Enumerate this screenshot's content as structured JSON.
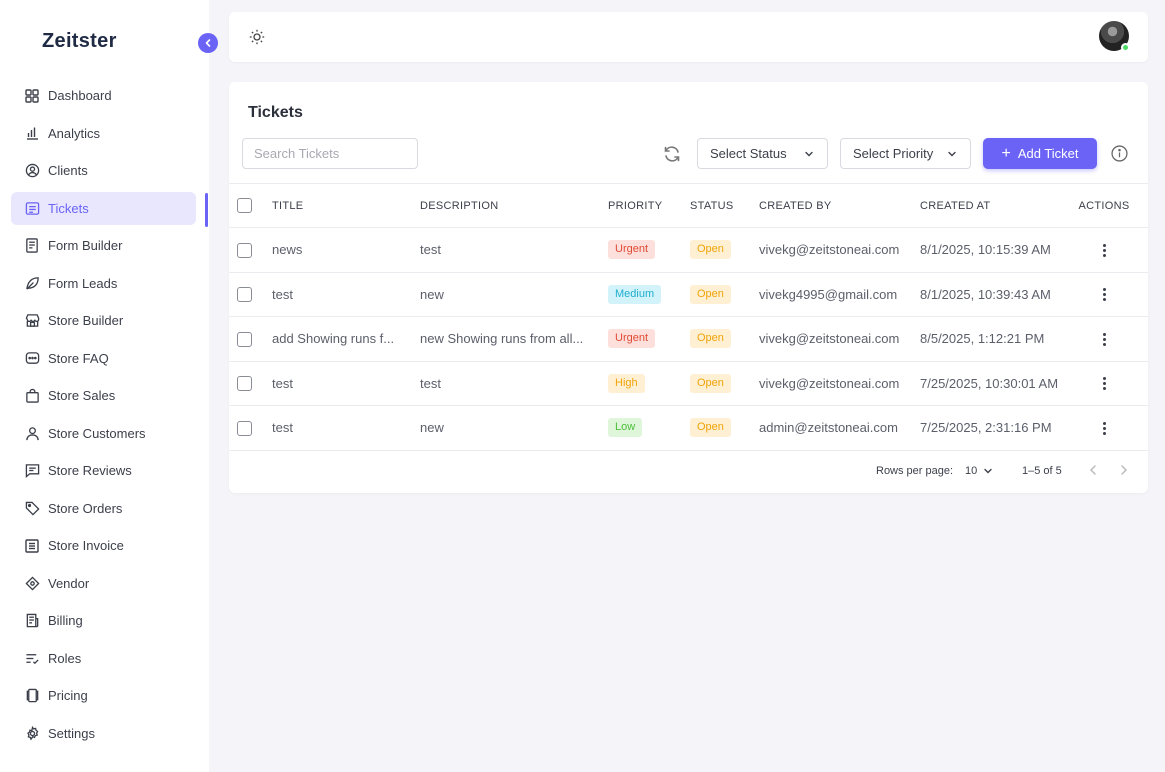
{
  "app": {
    "logo_text": "Zeitster"
  },
  "sidebar": {
    "items": [
      {
        "label": "Dashboard",
        "icon": "grid-icon"
      },
      {
        "label": "Analytics",
        "icon": "bar-chart-icon"
      },
      {
        "label": "Clients",
        "icon": "user-circle-icon"
      },
      {
        "label": "Tickets",
        "icon": "ticket-list-icon",
        "active": true
      },
      {
        "label": "Form Builder",
        "icon": "form-icon"
      },
      {
        "label": "Form Leads",
        "icon": "leaf-icon"
      },
      {
        "label": "Store Builder",
        "icon": "store-icon"
      },
      {
        "label": "Store FAQ",
        "icon": "chat-dots-icon"
      },
      {
        "label": "Store Sales",
        "icon": "shopping-bag-icon"
      },
      {
        "label": "Store Customers",
        "icon": "person-icon"
      },
      {
        "label": "Store Reviews",
        "icon": "message-icon"
      },
      {
        "label": "Store Orders",
        "icon": "tag-icon"
      },
      {
        "label": "Store Invoice",
        "icon": "invoice-icon"
      },
      {
        "label": "Vendor",
        "icon": "vendor-icon"
      },
      {
        "label": "Billing",
        "icon": "receipt-icon"
      },
      {
        "label": "Roles",
        "icon": "roles-list-icon"
      },
      {
        "label": "Pricing",
        "icon": "pricing-icon"
      },
      {
        "label": "Settings",
        "icon": "gear-icon"
      }
    ]
  },
  "tickets": {
    "title": "Tickets",
    "search_placeholder": "Search Tickets",
    "status_select": "Select Status",
    "priority_select": "Select Priority",
    "add_button": "Add Ticket",
    "columns": [
      "TITLE",
      "DESCRIPTION",
      "PRIORITY",
      "STATUS",
      "CREATED BY",
      "CREATED AT",
      "ACTIONS"
    ],
    "rows": [
      {
        "title": "news",
        "description": "test",
        "priority": "Urgent",
        "status": "Open",
        "created_by": "vivekg@zeitstoneai.com",
        "created_at": "8/1/2025, 10:15:39 AM"
      },
      {
        "title": "test",
        "description": "new",
        "priority": "Medium",
        "status": "Open",
        "created_by": "vivekg4995@gmail.com",
        "created_at": "8/1/2025, 10:39:43 AM"
      },
      {
        "title": "add Showing runs f...",
        "description": "new Showing runs from all...",
        "priority": "Urgent",
        "status": "Open",
        "created_by": "vivekg@zeitstoneai.com",
        "created_at": "8/5/2025, 1:12:21 PM"
      },
      {
        "title": "test",
        "description": "test",
        "priority": "High",
        "status": "Open",
        "created_by": "vivekg@zeitstoneai.com",
        "created_at": "7/25/2025, 10:30:01 AM"
      },
      {
        "title": "test",
        "description": "new",
        "priority": "Low",
        "status": "Open",
        "created_by": "admin@zeitstoneai.com",
        "created_at": "7/25/2025, 2:31:16 PM"
      }
    ],
    "pagination": {
      "rows_per_page_label": "Rows per page:",
      "rows_per_page": "10",
      "range": "1–5 of 5"
    }
  },
  "colors": {
    "accent": "#6b63f6",
    "urgent": "#e04a34",
    "medium": "#1eaecf",
    "high": "#f0a30a",
    "low": "#4cbf3a",
    "open": "#f0a30a"
  }
}
